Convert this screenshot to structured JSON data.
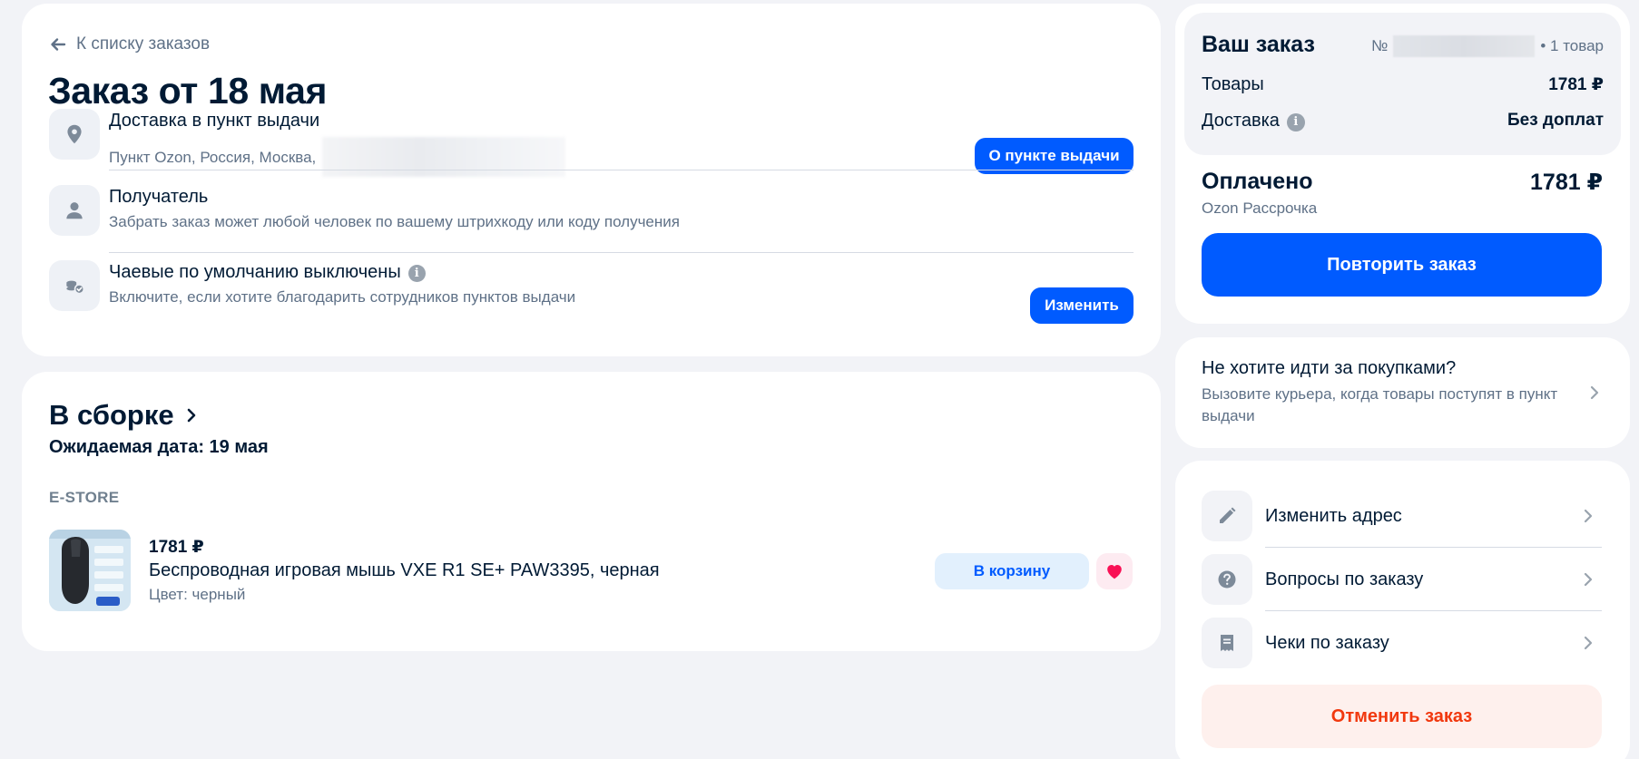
{
  "order": {
    "back_label": "К списку заказов",
    "title": "Заказ от 18 мая"
  },
  "delivery": {
    "title": "Доставка в пункт выдачи",
    "address": "Пункт Ozon, Россия, Москва,",
    "button": "О пункте выдачи"
  },
  "recipient": {
    "title": "Получатель",
    "subtitle": "Забрать заказ может любой человек по вашему штрихкоду или коду получения"
  },
  "tips": {
    "title": "Чаевые по умолчанию выключены",
    "subtitle": "Включите, если хотите благодарить сотрудников пунктов выдачи",
    "button": "Изменить"
  },
  "shipment": {
    "status": "В сборке",
    "expected_date": "Ожидаемая дата: 19 мая",
    "seller": "E-STORE",
    "product": {
      "price": "1781 ₽",
      "name": "Беспроводная игровая мышь VXE R1 SE+ PAW3395, черная",
      "color": "Цвет: черный",
      "cart_button": "В корзину"
    }
  },
  "summary": {
    "title": "Ваш заказ",
    "number_prefix": "№",
    "items_count": "• 1 товар",
    "goods_label": "Товары",
    "goods_value": "1781 ₽",
    "delivery_label": "Доставка",
    "delivery_value": "Без доплат",
    "paid_label": "Оплачено",
    "paid_value": "1781 ₽",
    "payment_method": "Ozon Рассрочка",
    "repeat_button": "Повторить заказ"
  },
  "courier": {
    "title": "Не хотите идти за покупками?",
    "subtitle": "Вызовите курьера, когда товары поступят в пункт выдачи"
  },
  "actions": {
    "items": [
      {
        "label": "Изменить адрес",
        "icon": "pencil-icon"
      },
      {
        "label": "Вопросы по заказу",
        "icon": "question-icon"
      },
      {
        "label": "Чеки по заказу",
        "icon": "receipt-icon"
      }
    ],
    "cancel_button": "Отменить заказ"
  },
  "colors": {
    "accent": "#005bff",
    "background": "#f2f3f7",
    "text": "#001a34",
    "secondary_text": "#5f7187",
    "cancel": "#f1380e",
    "favorite": "#f91155"
  }
}
